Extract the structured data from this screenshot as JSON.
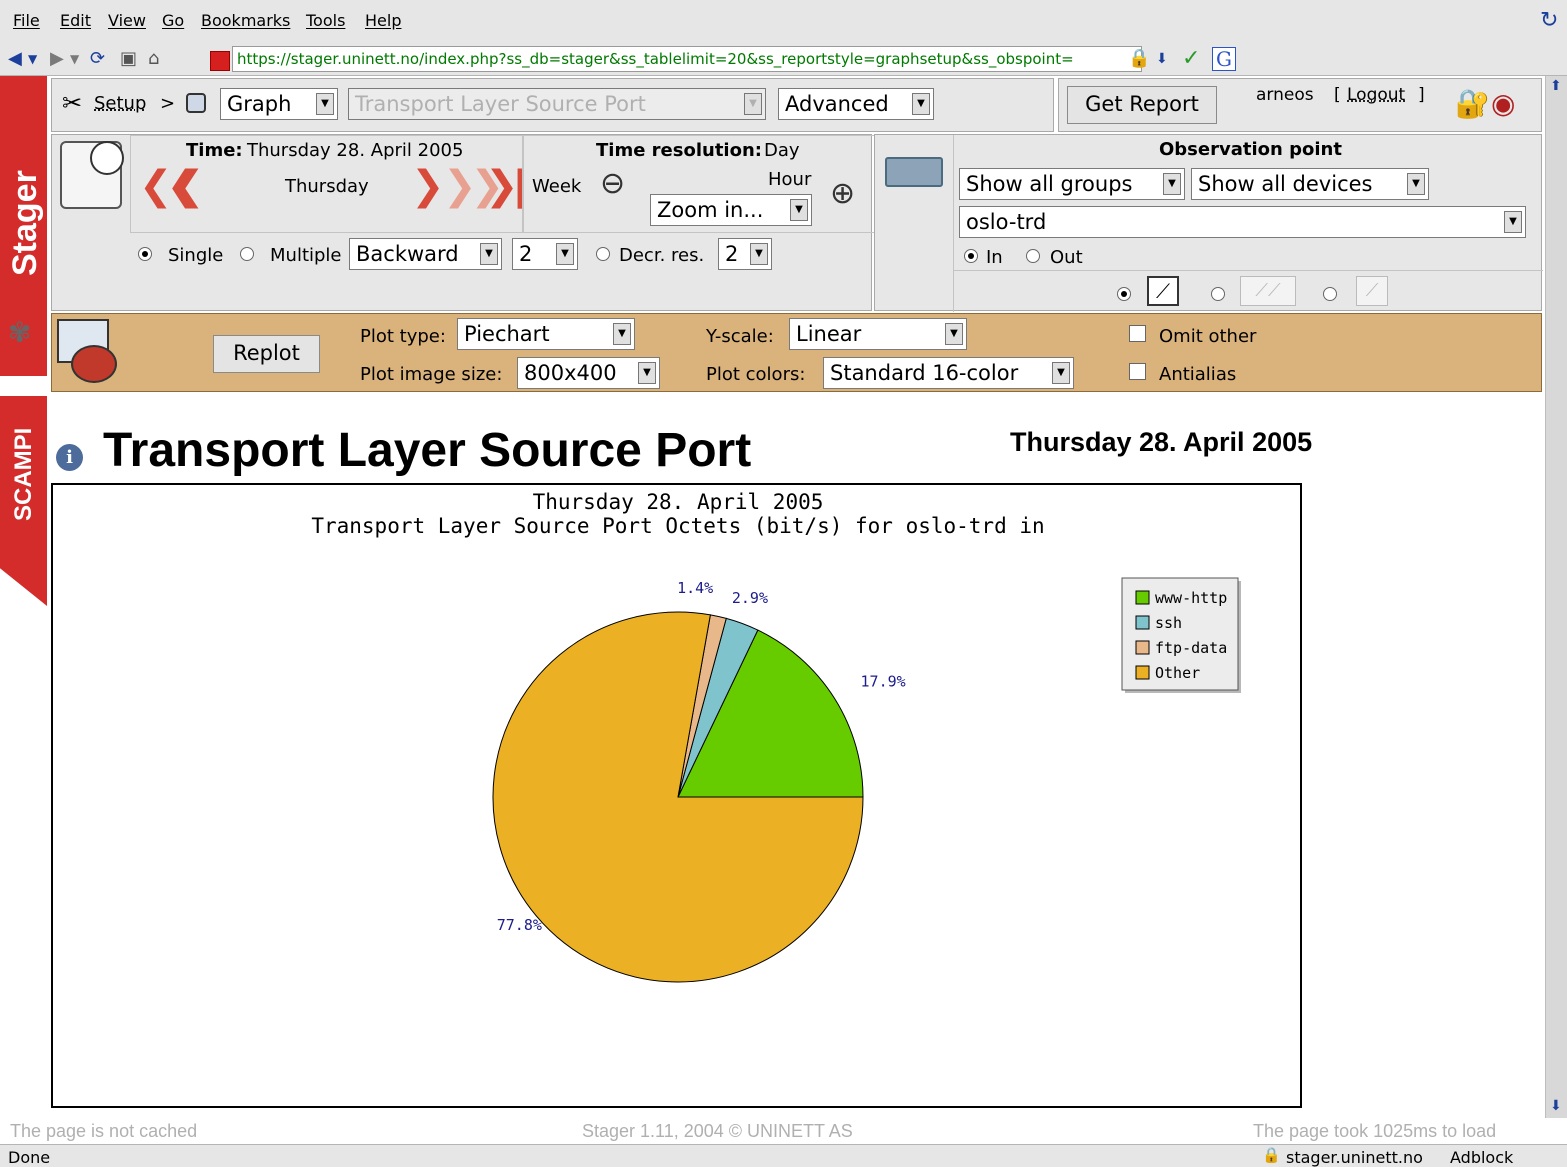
{
  "menubar": {
    "items": [
      "File",
      "Edit",
      "View",
      "Go",
      "Bookmarks",
      "Tools",
      "Help"
    ]
  },
  "navbar": {
    "url": "https://stager.uninett.no/index.php?ss_db=stager&ss_tablelimit=20&ss_reportstyle=graphsetup&ss_obspoint=",
    "search_engine_letter": "G"
  },
  "sidebar": {
    "brand": "Stager",
    "sub_brand": "SCAMPI"
  },
  "toolbar": {
    "setup_label": "Setup",
    "breadcrumb_sep": ">",
    "view_select": "Graph",
    "report_select": "Transport Layer Source Port",
    "mode_select": "Advanced",
    "get_report_label": "Get Report",
    "username": "arneos",
    "logout_label": "Logout"
  },
  "time": {
    "label": "Time:",
    "value": "Thursday 28. April 2005",
    "current_day": "Thursday",
    "resolution_label": "Time resolution:",
    "resolution_value": "Day",
    "zoom_out_label": "Week",
    "zoom_in_label": "Hour",
    "zoom_select": "Zoom in...",
    "single_label": "Single",
    "multiple_label": "Multiple",
    "direction_select": "Backward",
    "count_select": "2",
    "decr_res_label": "Decr. res.",
    "decr_res_select": "2"
  },
  "observation": {
    "title": "Observation point",
    "groups_select": "Show all groups",
    "devices_select": "Show all devices",
    "device_select": "oslo-trd",
    "in_label": "In",
    "out_label": "Out"
  },
  "plot": {
    "replot_label": "Replot",
    "type_label": "Plot type:",
    "type_value": "Piechart",
    "size_label": "Plot image size:",
    "size_value": "800x400",
    "yscale_label": "Y-scale:",
    "yscale_value": "Linear",
    "colors_label": "Plot colors:",
    "colors_value": "Standard 16-color",
    "omit_label": "Omit other",
    "antialias_label": "Antialias"
  },
  "page": {
    "title": "Transport Layer Source Port",
    "date": "Thursday 28. April 2005"
  },
  "chart_data": {
    "type": "pie",
    "title": "Thursday 28. April 2005",
    "subtitle": "Transport Layer Source Port Octets (bit/s) for oslo-trd in",
    "categories": [
      "www-http",
      "ssh",
      "ftp-data",
      "Other"
    ],
    "values": [
      17.9,
      2.9,
      1.4,
      77.8
    ],
    "labels": [
      "17.9%",
      "2.9%",
      "1.4%",
      "77.8%"
    ],
    "colors": [
      "#66cc00",
      "#7fc4cc",
      "#e8b88a",
      "#ebb023"
    ],
    "legend_position": "top-right"
  },
  "footer": {
    "cache_note": "The page is not cached",
    "copyright": "Stager 1.11, 2004 © UNINETT AS",
    "load_time": "The page took 1025ms to load"
  },
  "statusbar": {
    "status": "Done",
    "host": "stager.uninett.no",
    "addon": "Adblock"
  }
}
